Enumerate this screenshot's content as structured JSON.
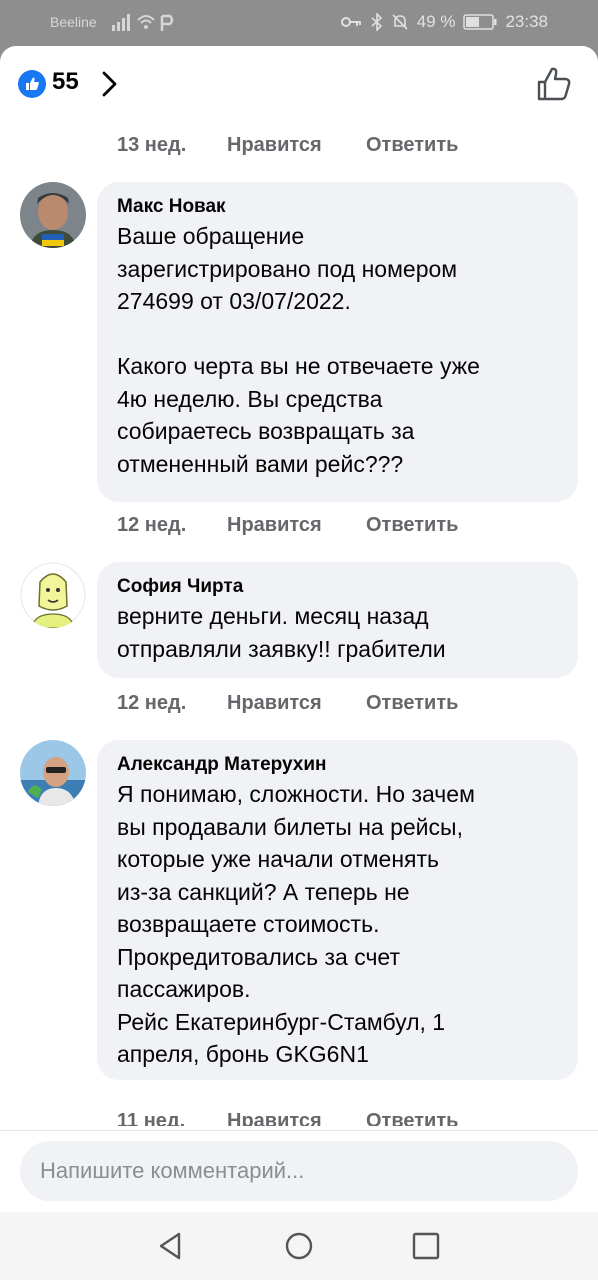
{
  "status": {
    "carrier": "Beeline",
    "battery": "49 %",
    "time": "23:38"
  },
  "header": {
    "like_count": "55"
  },
  "comments": [
    {
      "meta": {
        "time": "13 нед.",
        "like": "Нравится",
        "reply": "Ответить"
      }
    },
    {
      "author": "Макс Новак",
      "text": "Ваше обращение\nзарегистрировано под номером\n274699 от 03/07/2022.\n\nКакого черта вы не отвечаете уже\n4ю неделю. Вы средства\nсобираетесь возвращать за\nотмененный вами рейс???",
      "meta": {
        "time": "12 нед.",
        "like": "Нравится",
        "reply": "Ответить"
      }
    },
    {
      "author": "София Чирта",
      "text": "верните деньги. месяц назад\nотправляли заявку!! грабители",
      "meta": {
        "time": "12 нед.",
        "like": "Нравится",
        "reply": "Ответить"
      }
    },
    {
      "author": "Александр Матерухин",
      "text": "Я понимаю, сложности. Но зачем\nвы продавали билеты на рейсы,\nкоторые уже начали отменять\nиз-за санкций? А теперь не\nвозвращаете стоимость.\nПрокредитовались за счет\nпассажиров.\nРейс Екатеринбург-Стамбул, 1\nапреля, бронь GKG6N1",
      "meta": {
        "time": "11 нед.",
        "like": "Нравится",
        "reply": "Ответить"
      }
    }
  ],
  "composer": {
    "placeholder": "Напишите комментарий..."
  }
}
